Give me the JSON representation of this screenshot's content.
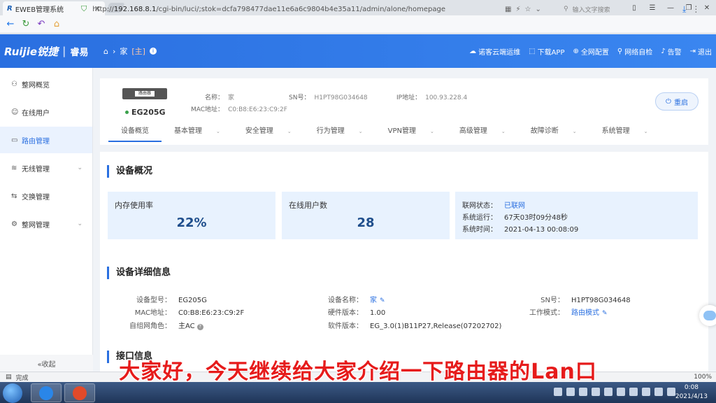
{
  "browser": {
    "tab_logo": "R",
    "tab_title": "EWEB管理系统",
    "url_prefix": "http://",
    "url_host": "192.168.8.1",
    "url_rest": "/cgi-bin/luci/;stok=dcfa798477dae11e6a6c9804b4e35a11/admin/alone/homepage",
    "search_placeholder": "输入文字搜索"
  },
  "header": {
    "brand": "Ruijie锐捷",
    "brand_sub": "睿易",
    "crumb_home": "家",
    "crumb_tag": "[主]",
    "actions": [
      "诺客云端运维",
      "下载APP",
      "全网配置",
      "网络自检",
      "告警",
      "退出"
    ]
  },
  "sidebar": {
    "items": [
      {
        "label": "整网概览",
        "icon": "network-icon"
      },
      {
        "label": "在线用户",
        "icon": "user-icon"
      },
      {
        "label": "路由管理",
        "icon": "router-icon"
      },
      {
        "label": "无线管理",
        "icon": "wifi-icon"
      },
      {
        "label": "交换管理",
        "icon": "switch-icon"
      },
      {
        "label": "整网管理",
        "icon": "settings-icon"
      }
    ],
    "collapse_label": "«收起"
  },
  "device": {
    "image_label": "路由器",
    "model": "EG205G",
    "name_label": "名称：",
    "name_value": "家",
    "mac_label": "MAC地址：",
    "mac_value": "C0:B8:E6:23:C9:2F",
    "sn_label": "SN号：",
    "sn_value": "H1PT98G034648",
    "ip_label": "IP地址：",
    "ip_value": "100.93.228.4",
    "reboot_label": "重启"
  },
  "tabs": [
    "设备概览",
    "基本管理",
    "安全管理",
    "行为管理",
    "VPN管理",
    "高级管理",
    "故障诊断",
    "系统管理"
  ],
  "overview": {
    "title": "设备概况",
    "memory_label": "内存使用率",
    "memory_value": "22%",
    "online_label": "在线用户数",
    "online_value": "28",
    "net_status_label": "联网状态：",
    "net_status_value": "已联网",
    "uptime_label": "系统运行：",
    "uptime_value": "67天03时09分48秒",
    "systime_label": "系统时间：",
    "systime_value": "2021-04-13 00:08:09"
  },
  "details": {
    "title": "设备详细信息",
    "model_label": "设备型号：",
    "model_value": "EG205G",
    "mac_label": "MAC地址：",
    "mac_value": "C0:B8:E6:23:C9:2F",
    "role_label": "自组网角色：",
    "role_value": "主AC",
    "devname_label": "设备名称：",
    "devname_value": "家",
    "hw_label": "硬件版本：",
    "hw_value": "1.00",
    "sw_label": "软件版本：",
    "sw_value": "EG_3.0(1)B11P27,Release(07202702)",
    "sn_label": "SN号：",
    "sn_value": "H1PT98G034648",
    "mode_label": "工作模式：",
    "mode_value": "路由模式"
  },
  "ports_title": "接口信息",
  "status_bar": {
    "left": "完成",
    "zoom": "100%"
  },
  "subtitle": "大家好，今天继续给大家介绍一下路由器的Lan口",
  "taskbar": {
    "time": "0:08",
    "date": "2021/4/13"
  },
  "colors": {
    "accent": "#2a6fe0",
    "subtitle": "#e61b1b"
  }
}
